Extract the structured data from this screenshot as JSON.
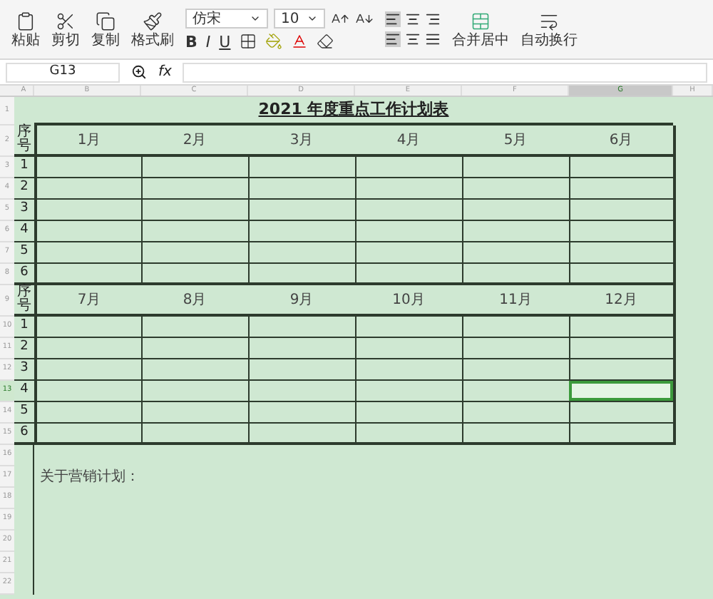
{
  "toolbar": {
    "clipboard": [
      {
        "kind": "paste",
        "label": "粘贴"
      },
      {
        "kind": "cut",
        "label": "剪切"
      },
      {
        "kind": "copy",
        "label": "复制"
      },
      {
        "kind": "painter",
        "label": "格式刷"
      }
    ],
    "font": "仿宋",
    "size": "10",
    "styles": [
      "B",
      "I",
      "U"
    ],
    "merge": "合并居中",
    "wrap": "自动换行"
  },
  "formula_bar": {
    "name_box": "G13",
    "fx": "fx"
  },
  "sheet": {
    "columns": [
      {
        "label": "A",
        "selected": false
      },
      {
        "label": "B",
        "selected": false
      },
      {
        "label": "C",
        "selected": false
      },
      {
        "label": "D",
        "selected": false
      },
      {
        "label": "E",
        "selected": false
      },
      {
        "label": "F",
        "selected": false
      },
      {
        "label": "G",
        "selected": true
      },
      {
        "label": "H",
        "selected": false
      }
    ],
    "row_labels": [
      {
        "label": "1",
        "selected": false
      },
      {
        "label": "2",
        "selected": false
      },
      {
        "label": "3",
        "selected": false
      },
      {
        "label": "4",
        "selected": false
      },
      {
        "label": "5",
        "selected": false
      },
      {
        "label": "6",
        "selected": false
      },
      {
        "label": "7",
        "selected": false
      },
      {
        "label": "8",
        "selected": false
      },
      {
        "label": "9",
        "selected": false
      },
      {
        "label": "10",
        "selected": false
      },
      {
        "label": "11",
        "selected": false
      },
      {
        "label": "12",
        "selected": false
      },
      {
        "label": "13",
        "selected": true
      },
      {
        "label": "14",
        "selected": false
      },
      {
        "label": "15",
        "selected": false
      },
      {
        "label": "16",
        "selected": false
      },
      {
        "label": "17",
        "selected": false
      },
      {
        "label": "18",
        "selected": false
      },
      {
        "label": "19",
        "selected": false
      },
      {
        "label": "20",
        "selected": false
      },
      {
        "label": "21",
        "selected": false
      },
      {
        "label": "22",
        "selected": false
      }
    ],
    "title": "2021 年度重点工作计划表",
    "sections": [
      {
        "header": "序号",
        "months": [
          "1月",
          "2月",
          "3月",
          "4月",
          "5月",
          "6月"
        ],
        "rows": [
          {
            "number": "1",
            "cells": [
              {
                "selected": false
              },
              {
                "selected": false
              },
              {
                "selected": false
              },
              {
                "selected": false
              },
              {
                "selected": false
              },
              {
                "selected": false
              }
            ]
          },
          {
            "number": "2",
            "cells": [
              {
                "selected": false
              },
              {
                "selected": false
              },
              {
                "selected": false
              },
              {
                "selected": false
              },
              {
                "selected": false
              },
              {
                "selected": false
              }
            ]
          },
          {
            "number": "3",
            "cells": [
              {
                "selected": false
              },
              {
                "selected": false
              },
              {
                "selected": false
              },
              {
                "selected": false
              },
              {
                "selected": false
              },
              {
                "selected": false
              }
            ]
          },
          {
            "number": "4",
            "cells": [
              {
                "selected": false
              },
              {
                "selected": false
              },
              {
                "selected": false
              },
              {
                "selected": false
              },
              {
                "selected": false
              },
              {
                "selected": false
              }
            ]
          },
          {
            "number": "5",
            "cells": [
              {
                "selected": false
              },
              {
                "selected": false
              },
              {
                "selected": false
              },
              {
                "selected": false
              },
              {
                "selected": false
              },
              {
                "selected": false
              }
            ]
          },
          {
            "number": "6",
            "cells": [
              {
                "selected": false
              },
              {
                "selected": false
              },
              {
                "selected": false
              },
              {
                "selected": false
              },
              {
                "selected": false
              },
              {
                "selected": false
              }
            ]
          }
        ]
      },
      {
        "header": "序号",
        "months": [
          "7月",
          "8月",
          "9月",
          "10月",
          "11月",
          "12月"
        ],
        "rows": [
          {
            "number": "1",
            "cells": [
              {
                "selected": false
              },
              {
                "selected": false
              },
              {
                "selected": false
              },
              {
                "selected": false
              },
              {
                "selected": false
              },
              {
                "selected": false
              }
            ]
          },
          {
            "number": "2",
            "cells": [
              {
                "selected": false
              },
              {
                "selected": false
              },
              {
                "selected": false
              },
              {
                "selected": false
              },
              {
                "selected": false
              },
              {
                "selected": false
              }
            ]
          },
          {
            "number": "3",
            "cells": [
              {
                "selected": false
              },
              {
                "selected": false
              },
              {
                "selected": false
              },
              {
                "selected": false
              },
              {
                "selected": false
              },
              {
                "selected": false
              }
            ]
          },
          {
            "number": "4",
            "cells": [
              {
                "selected": false
              },
              {
                "selected": false
              },
              {
                "selected": false
              },
              {
                "selected": false
              },
              {
                "selected": false
              },
              {
                "selected": true
              }
            ]
          },
          {
            "number": "5",
            "cells": [
              {
                "selected": false
              },
              {
                "selected": false
              },
              {
                "selected": false
              },
              {
                "selected": false
              },
              {
                "selected": false
              },
              {
                "selected": false
              }
            ]
          },
          {
            "number": "6",
            "cells": [
              {
                "selected": false
              },
              {
                "selected": false
              },
              {
                "selected": false
              },
              {
                "selected": false
              },
              {
                "selected": false
              },
              {
                "selected": false
              }
            ]
          }
        ]
      }
    ],
    "note": "关于营销计划："
  }
}
